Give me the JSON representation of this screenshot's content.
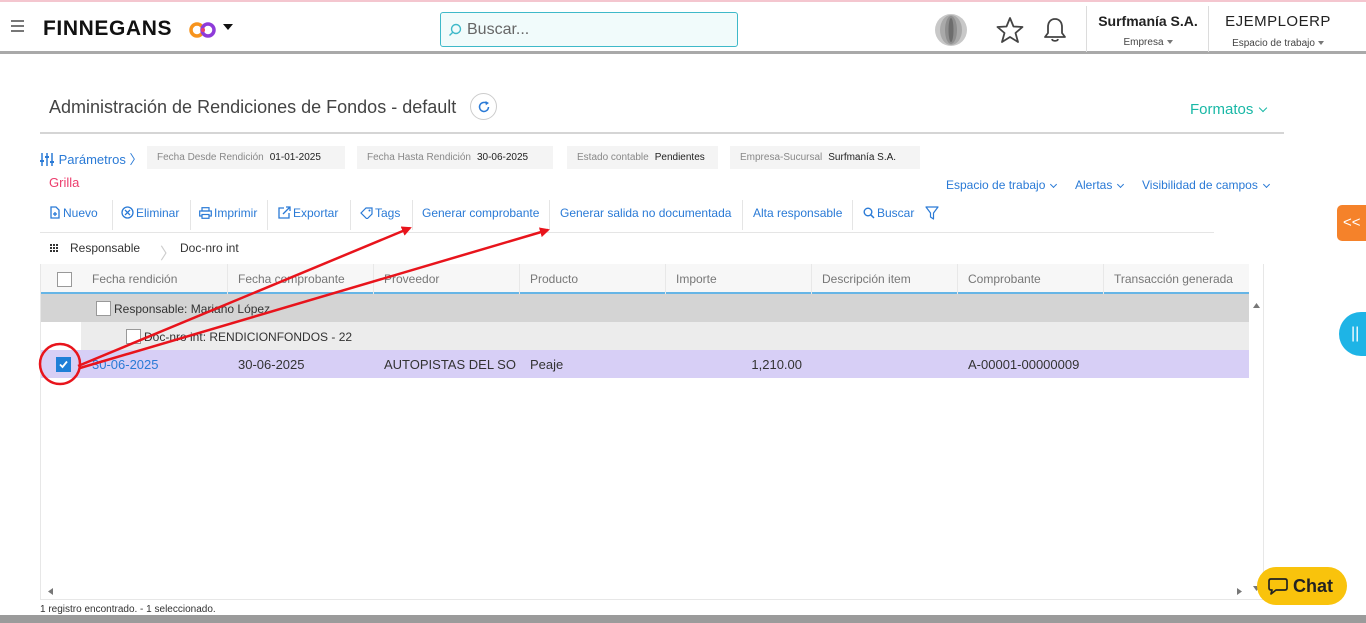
{
  "topbar": {
    "brand": "FINNEGANS",
    "search_placeholder": "Buscar...",
    "company_name": "Surfmanía S.A.",
    "company_label": "Empresa",
    "workspace_name": "EJEMPLOERP",
    "workspace_label": "Espacio de trabajo"
  },
  "page": {
    "title": "Administración de Rendiciones de Fondos - default",
    "formatos": "Formatos",
    "grilla": "Grilla"
  },
  "params": {
    "link": "Parámetros",
    "filters": [
      {
        "label": "Fecha Desde Rendición",
        "value": "01-01-2025"
      },
      {
        "label": "Fecha Hasta Rendición",
        "value": "30-06-2025"
      },
      {
        "label": "Estado contable",
        "value": "Pendientes"
      },
      {
        "label": "Empresa-Sucursal",
        "value": "Surfmanía S.A."
      }
    ]
  },
  "view_links": {
    "workspace": "Espacio de trabajo",
    "alerts": "Alertas",
    "visibility": "Visibilidad de campos"
  },
  "toolbar": {
    "nuevo": "Nuevo",
    "eliminar": "Eliminar",
    "imprimir": "Imprimir",
    "exportar": "Exportar",
    "tags": "Tags",
    "generar_comprobante": "Generar comprobante",
    "generar_salida": "Generar salida no documentada",
    "alta_responsable": "Alta responsable",
    "buscar": "Buscar"
  },
  "grouping": [
    "Responsable",
    "Doc-nro int"
  ],
  "grid": {
    "columns": [
      "Fecha rendición",
      "Fecha comprobante",
      "Proveedor",
      "Producto",
      "Importe",
      "Descripción item",
      "Comprobante",
      "Transacción generada"
    ],
    "group1": "Responsable: Mariano López",
    "group2": "Doc-nro int: RENDICIONFONDOS - 22",
    "rows": [
      {
        "fecha_rendicion": "30-06-2025",
        "fecha_comprobante": "30-06-2025",
        "proveedor": "AUTOPISTAS DEL SO",
        "producto": "Peaje",
        "importe": "1,210.00",
        "descripcion": "",
        "comprobante": "A-00001-00000009",
        "transaccion": "",
        "selected": true
      }
    ]
  },
  "footer": {
    "status": "1 registro encontrado. - 1 seleccionado."
  },
  "side": {
    "collapse": "<<",
    "pause": "||",
    "chat": "Chat"
  },
  "colors": {
    "accent_blue": "#2a7ad6",
    "teal": "#19b8a6",
    "pink": "#ec3d6d",
    "selected_row": "#d7cff6",
    "annotation_red": "#e8141c",
    "chat_yellow": "#f9c30c",
    "orange_tab": "#f5822a",
    "blue_tab": "#1eb4e6"
  }
}
